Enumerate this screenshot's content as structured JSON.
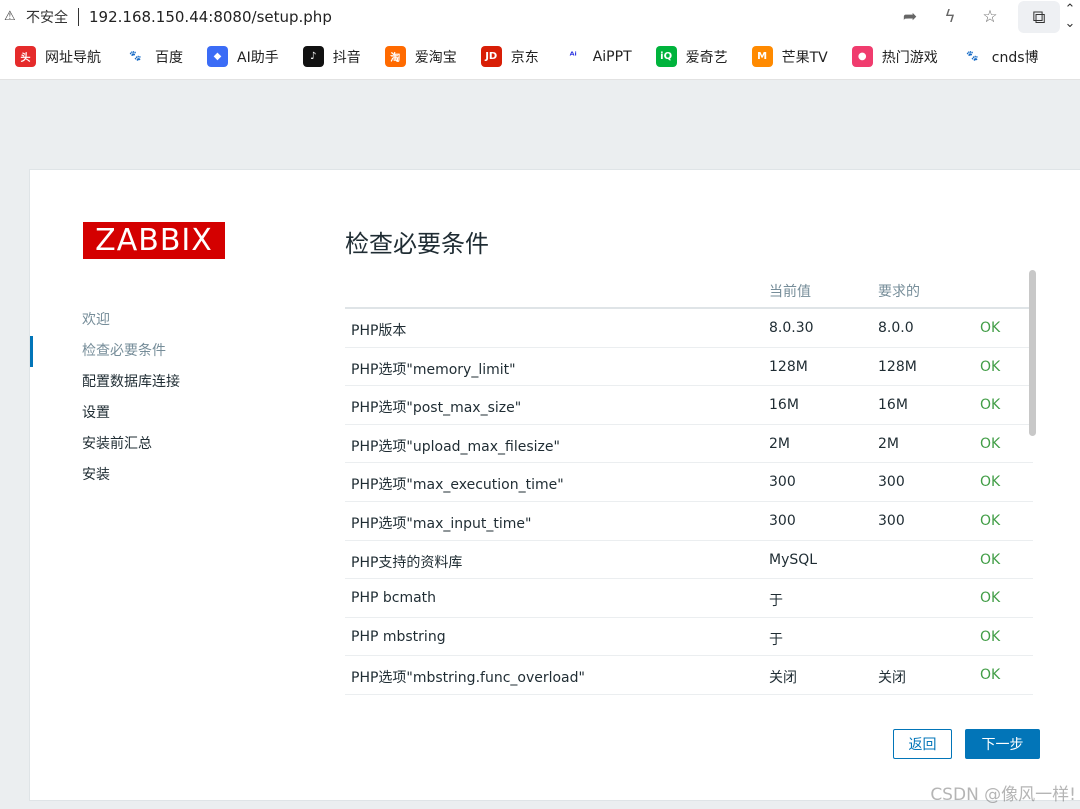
{
  "browser": {
    "security_label": "不安全",
    "url": "192.168.150.44:8080/setup.php"
  },
  "bookmarks": [
    {
      "label": "网址导航",
      "icon": "red-flag",
      "color": "#e52b2b",
      "glyph": "头"
    },
    {
      "label": "百度",
      "icon": "baidu-paw",
      "color": "#ffffff",
      "glyph": "🐾"
    },
    {
      "label": "AI助手",
      "icon": "ai-assistant",
      "color": "#3b6cf6",
      "glyph": "◆"
    },
    {
      "label": "抖音",
      "icon": "douyin",
      "color": "#111111",
      "glyph": "♪"
    },
    {
      "label": "爱淘宝",
      "icon": "taobao",
      "color": "#ff6a00",
      "glyph": "淘"
    },
    {
      "label": "京东",
      "icon": "jd",
      "color": "#d81e06",
      "glyph": "JD"
    },
    {
      "label": "AiPPT",
      "icon": "aippt",
      "color": "#ffffff",
      "glyph": "ᴬⁱ"
    },
    {
      "label": "爱奇艺",
      "icon": "iqiyi",
      "color": "#00b33c",
      "glyph": "iQ"
    },
    {
      "label": "芒果TV",
      "icon": "mango",
      "color": "#ff8a00",
      "glyph": "M"
    },
    {
      "label": "热门游戏",
      "icon": "game",
      "color": "#f03c6e",
      "glyph": "●"
    },
    {
      "label": "cnds博",
      "icon": "baidu-paw",
      "color": "#ffffff",
      "glyph": "🐾"
    }
  ],
  "logo": "ZABBIX",
  "steps": [
    {
      "label": "欢迎",
      "state": "done"
    },
    {
      "label": "检查必要条件",
      "state": "current"
    },
    {
      "label": "配置数据库连接",
      "state": "todo"
    },
    {
      "label": "设置",
      "state": "todo"
    },
    {
      "label": "安装前汇总",
      "state": "todo"
    },
    {
      "label": "安装",
      "state": "todo"
    }
  ],
  "page_title": "检查必要条件",
  "table": {
    "headers": {
      "current": "当前值",
      "required": "要求的"
    },
    "rows": [
      {
        "name": "PHP版本",
        "current": "8.0.30",
        "required": "8.0.0",
        "status": "OK"
      },
      {
        "name": "PHP选项\"memory_limit\"",
        "current": "128M",
        "required": "128M",
        "status": "OK"
      },
      {
        "name": "PHP选项\"post_max_size\"",
        "current": "16M",
        "required": "16M",
        "status": "OK"
      },
      {
        "name": "PHP选项\"upload_max_filesize\"",
        "current": "2M",
        "required": "2M",
        "status": "OK"
      },
      {
        "name": "PHP选项\"max_execution_time\"",
        "current": "300",
        "required": "300",
        "status": "OK"
      },
      {
        "name": "PHP选项\"max_input_time\"",
        "current": "300",
        "required": "300",
        "status": "OK"
      },
      {
        "name": "PHP支持的资料库",
        "current": "MySQL",
        "required": "",
        "status": "OK"
      },
      {
        "name": "PHP bcmath",
        "current": "于",
        "required": "",
        "status": "OK"
      },
      {
        "name": "PHP mbstring",
        "current": "于",
        "required": "",
        "status": "OK"
      },
      {
        "name": "PHP选项\"mbstring.func_overload\"",
        "current": "关闭",
        "required": "关闭",
        "status": "OK"
      }
    ]
  },
  "buttons": {
    "back": "返回",
    "next": "下一步"
  },
  "watermark": "CSDN @像风一样!",
  "colors": {
    "logo_bg": "#d40000",
    "ok": "#429e47",
    "accent": "#0275b8"
  }
}
